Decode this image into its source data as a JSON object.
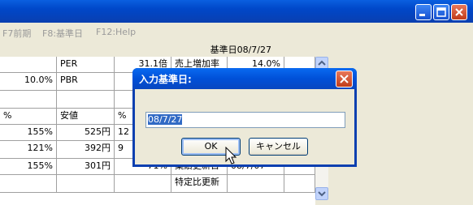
{
  "menu": {
    "f7": "F7前期",
    "f8": "F8:基準日",
    "f12": "F12:Help"
  },
  "datebar": {
    "label": "基準日08/7/27"
  },
  "table": {
    "rows": [
      [
        "",
        "PER",
        "31.1倍",
        "売上増加率",
        "14.0%"
      ],
      [
        "10.0%",
        "PBR",
        "",
        "",
        ""
      ],
      [
        "",
        "",
        "",
        "",
        ""
      ],
      [
        "%",
        "安値",
        "%",
        "",
        ""
      ],
      [
        "155%",
        "525円",
        "12",
        "",
        ""
      ],
      [
        "121%",
        "392円",
        "9",
        "",
        ""
      ],
      [
        "155%",
        "301円",
        "71%",
        "業績更新日",
        "08/7/07"
      ],
      [
        "",
        "",
        "",
        "特定比更新",
        ""
      ]
    ]
  },
  "dialog": {
    "title": "入力基準日:",
    "input_value": "08/7/27",
    "ok_label": "OK",
    "cancel_label": "キャンセル"
  }
}
